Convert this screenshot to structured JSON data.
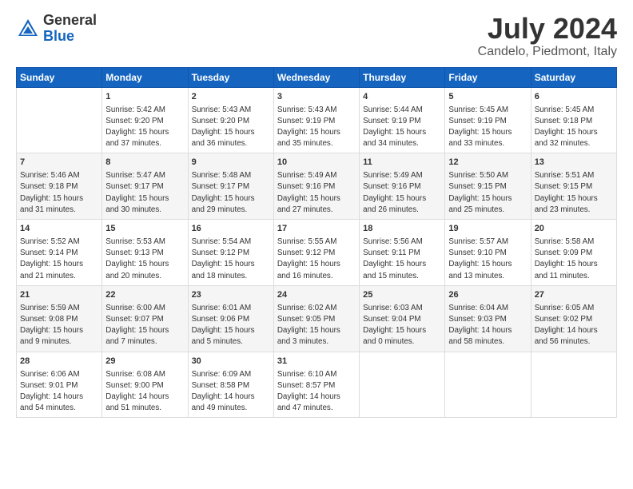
{
  "header": {
    "logo_general": "General",
    "logo_blue": "Blue",
    "title": "July 2024",
    "subtitle": "Candelo, Piedmont, Italy"
  },
  "columns": [
    "Sunday",
    "Monday",
    "Tuesday",
    "Wednesday",
    "Thursday",
    "Friday",
    "Saturday"
  ],
  "weeks": [
    [
      {
        "num": "",
        "info": ""
      },
      {
        "num": "1",
        "info": "Sunrise: 5:42 AM\nSunset: 9:20 PM\nDaylight: 15 hours\nand 37 minutes."
      },
      {
        "num": "2",
        "info": "Sunrise: 5:43 AM\nSunset: 9:20 PM\nDaylight: 15 hours\nand 36 minutes."
      },
      {
        "num": "3",
        "info": "Sunrise: 5:43 AM\nSunset: 9:19 PM\nDaylight: 15 hours\nand 35 minutes."
      },
      {
        "num": "4",
        "info": "Sunrise: 5:44 AM\nSunset: 9:19 PM\nDaylight: 15 hours\nand 34 minutes."
      },
      {
        "num": "5",
        "info": "Sunrise: 5:45 AM\nSunset: 9:19 PM\nDaylight: 15 hours\nand 33 minutes."
      },
      {
        "num": "6",
        "info": "Sunrise: 5:45 AM\nSunset: 9:18 PM\nDaylight: 15 hours\nand 32 minutes."
      }
    ],
    [
      {
        "num": "7",
        "info": "Sunrise: 5:46 AM\nSunset: 9:18 PM\nDaylight: 15 hours\nand 31 minutes."
      },
      {
        "num": "8",
        "info": "Sunrise: 5:47 AM\nSunset: 9:17 PM\nDaylight: 15 hours\nand 30 minutes."
      },
      {
        "num": "9",
        "info": "Sunrise: 5:48 AM\nSunset: 9:17 PM\nDaylight: 15 hours\nand 29 minutes."
      },
      {
        "num": "10",
        "info": "Sunrise: 5:49 AM\nSunset: 9:16 PM\nDaylight: 15 hours\nand 27 minutes."
      },
      {
        "num": "11",
        "info": "Sunrise: 5:49 AM\nSunset: 9:16 PM\nDaylight: 15 hours\nand 26 minutes."
      },
      {
        "num": "12",
        "info": "Sunrise: 5:50 AM\nSunset: 9:15 PM\nDaylight: 15 hours\nand 25 minutes."
      },
      {
        "num": "13",
        "info": "Sunrise: 5:51 AM\nSunset: 9:15 PM\nDaylight: 15 hours\nand 23 minutes."
      }
    ],
    [
      {
        "num": "14",
        "info": "Sunrise: 5:52 AM\nSunset: 9:14 PM\nDaylight: 15 hours\nand 21 minutes."
      },
      {
        "num": "15",
        "info": "Sunrise: 5:53 AM\nSunset: 9:13 PM\nDaylight: 15 hours\nand 20 minutes."
      },
      {
        "num": "16",
        "info": "Sunrise: 5:54 AM\nSunset: 9:12 PM\nDaylight: 15 hours\nand 18 minutes."
      },
      {
        "num": "17",
        "info": "Sunrise: 5:55 AM\nSunset: 9:12 PM\nDaylight: 15 hours\nand 16 minutes."
      },
      {
        "num": "18",
        "info": "Sunrise: 5:56 AM\nSunset: 9:11 PM\nDaylight: 15 hours\nand 15 minutes."
      },
      {
        "num": "19",
        "info": "Sunrise: 5:57 AM\nSunset: 9:10 PM\nDaylight: 15 hours\nand 13 minutes."
      },
      {
        "num": "20",
        "info": "Sunrise: 5:58 AM\nSunset: 9:09 PM\nDaylight: 15 hours\nand 11 minutes."
      }
    ],
    [
      {
        "num": "21",
        "info": "Sunrise: 5:59 AM\nSunset: 9:08 PM\nDaylight: 15 hours\nand 9 minutes."
      },
      {
        "num": "22",
        "info": "Sunrise: 6:00 AM\nSunset: 9:07 PM\nDaylight: 15 hours\nand 7 minutes."
      },
      {
        "num": "23",
        "info": "Sunrise: 6:01 AM\nSunset: 9:06 PM\nDaylight: 15 hours\nand 5 minutes."
      },
      {
        "num": "24",
        "info": "Sunrise: 6:02 AM\nSunset: 9:05 PM\nDaylight: 15 hours\nand 3 minutes."
      },
      {
        "num": "25",
        "info": "Sunrise: 6:03 AM\nSunset: 9:04 PM\nDaylight: 15 hours\nand 0 minutes."
      },
      {
        "num": "26",
        "info": "Sunrise: 6:04 AM\nSunset: 9:03 PM\nDaylight: 14 hours\nand 58 minutes."
      },
      {
        "num": "27",
        "info": "Sunrise: 6:05 AM\nSunset: 9:02 PM\nDaylight: 14 hours\nand 56 minutes."
      }
    ],
    [
      {
        "num": "28",
        "info": "Sunrise: 6:06 AM\nSunset: 9:01 PM\nDaylight: 14 hours\nand 54 minutes."
      },
      {
        "num": "29",
        "info": "Sunrise: 6:08 AM\nSunset: 9:00 PM\nDaylight: 14 hours\nand 51 minutes."
      },
      {
        "num": "30",
        "info": "Sunrise: 6:09 AM\nSunset: 8:58 PM\nDaylight: 14 hours\nand 49 minutes."
      },
      {
        "num": "31",
        "info": "Sunrise: 6:10 AM\nSunset: 8:57 PM\nDaylight: 14 hours\nand 47 minutes."
      },
      {
        "num": "",
        "info": ""
      },
      {
        "num": "",
        "info": ""
      },
      {
        "num": "",
        "info": ""
      }
    ]
  ]
}
